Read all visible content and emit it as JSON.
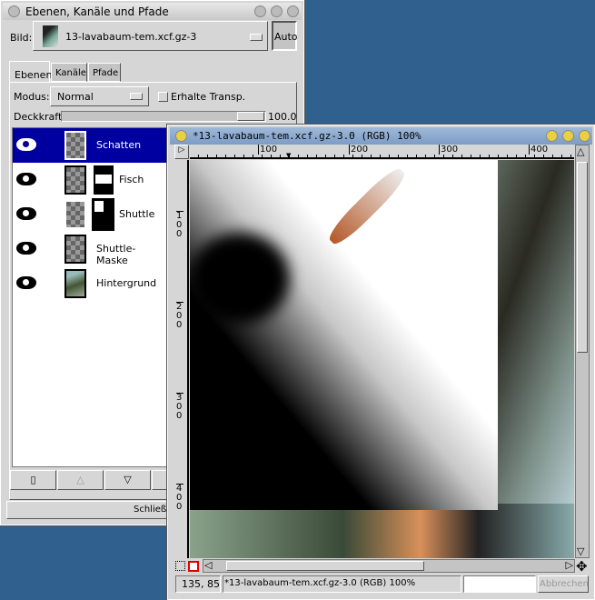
{
  "layers_dialog": {
    "title": "Ebenen, Kanäle und Pfade",
    "image_label": "Bild:",
    "image_value": "13-lavabaum-tem.xcf.gz-3",
    "auto_label": "Auto",
    "tabs": [
      {
        "label": "Ebenen",
        "active": true
      },
      {
        "label": "Kanäle"
      },
      {
        "label": "Pfade"
      }
    ],
    "mode_label": "Modus:",
    "mode_value": "Normal",
    "preserve_label": "Erhalte Transp.",
    "preserve_checked": false,
    "opacity_label": "Deckkraft:",
    "opacity_value": "100.0",
    "layers": [
      {
        "name": "Schatten",
        "visible": true,
        "selected": true
      },
      {
        "name": "Fisch",
        "visible": true,
        "mask": true
      },
      {
        "name": "Shuttle",
        "visible": true,
        "mask": true
      },
      {
        "name": "Shuttle-Maske",
        "visible": true
      },
      {
        "name": "Hintergrund",
        "visible": true
      }
    ],
    "close_label": "Schließen"
  },
  "image_window": {
    "title": "*13-lavabaum-tem.xcf.gz-3.0 (RGB) 100%",
    "hruler": [
      "100",
      "200",
      "300",
      "400"
    ],
    "vruler": [
      "100",
      "200",
      "300",
      "400"
    ],
    "coords": "135, 85",
    "status": "*13-lavabaum-tem.xcf.gz-3.0 (RGB) 100%",
    "cancel_label": "Abbrechen"
  },
  "colors": {
    "desktop": "#30608e",
    "selection": "#0000a0",
    "quickmask": "#e00000"
  }
}
